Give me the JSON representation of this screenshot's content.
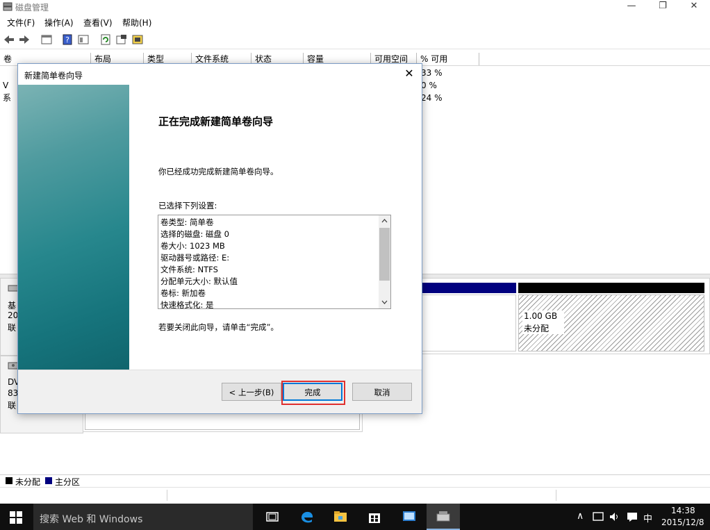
{
  "window": {
    "title": "磁盘管理",
    "controls": {
      "minimize": "—",
      "maximize": "❐",
      "close": "✕"
    }
  },
  "menu": [
    "文件(F)",
    "操作(A)",
    "查看(V)",
    "帮助(H)"
  ],
  "toolbar_icons": [
    "back-icon",
    "forward-icon",
    "console-icon",
    "help-icon",
    "view-icon",
    "refresh-icon",
    "properties-icon",
    "settings-icon"
  ],
  "volume_table": {
    "columns": [
      "卷",
      "布局",
      "类型",
      "文件系统",
      "状态",
      "容量",
      "可用空间",
      "% 可用"
    ],
    "rows": [
      {
        "name": "",
        "percent_free": "33 %"
      },
      {
        "name": "V",
        "percent_free": "0 %"
      },
      {
        "name": "系",
        "percent_free": "24 %"
      }
    ]
  },
  "disks": [
    {
      "label_lines": [
        "基",
        "20",
        "联"
      ]
    },
    {
      "label_lines": [
        "DV",
        "83",
        "联"
      ]
    }
  ],
  "unallocated_partition": {
    "size": "1.00 GB",
    "status": "未分配"
  },
  "legend": [
    {
      "label": "未分配",
      "color": "#000000"
    },
    {
      "label": "主分区",
      "color": "#00007f"
    }
  ],
  "wizard": {
    "title": "新建简单卷向导",
    "heading": "正在完成新建简单卷向导",
    "intro": "你已经成功完成新建简单卷向导。",
    "settings_label": "已选择下列设置:",
    "settings": [
      "卷类型: 简单卷",
      "选择的磁盘: 磁盘 0",
      "卷大小: 1023 MB",
      "驱动器号或路径: E:",
      "文件系统: NTFS",
      "分配单元大小: 默认值",
      "卷标: 新加卷",
      "快速格式化: 是"
    ],
    "closing_note": "若要关闭此向导，请单击“完成”。",
    "buttons": {
      "back": "< 上一步(B)",
      "finish": "完成",
      "cancel": "取消"
    }
  },
  "taskbar": {
    "search_placeholder": "搜索 Web 和 Windows",
    "ime": "中",
    "time": "14:38",
    "date": "2015/12/8"
  }
}
